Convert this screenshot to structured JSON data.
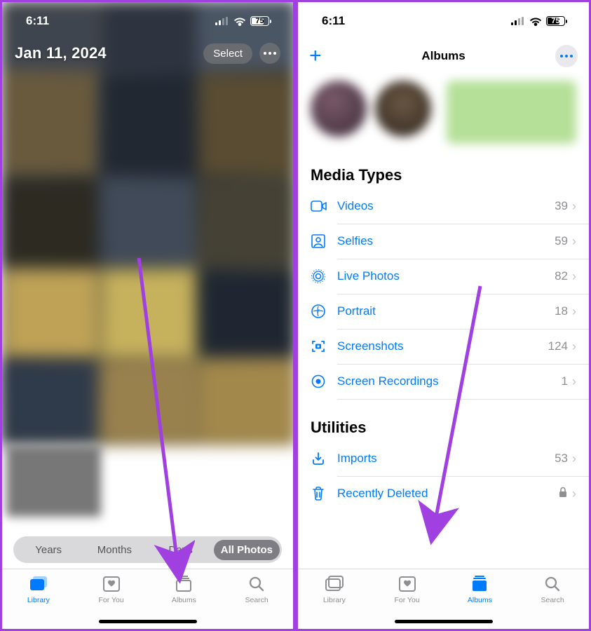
{
  "status": {
    "time": "6:11",
    "battery_pct": 75,
    "battery_label": "75"
  },
  "left": {
    "date_label": "Jan 11, 2024",
    "select_label": "Select",
    "segmented": [
      "Years",
      "Months",
      "Days",
      "All Photos"
    ],
    "active_segment_index": 3
  },
  "right": {
    "nav_title": "Albums",
    "sections": {
      "media_types": {
        "header": "Media Types",
        "items": [
          {
            "icon": "video",
            "label": "Videos",
            "count": 39
          },
          {
            "icon": "selfie",
            "label": "Selfies",
            "count": 59
          },
          {
            "icon": "live",
            "label": "Live Photos",
            "count": 82
          },
          {
            "icon": "portrait",
            "label": "Portrait",
            "count": 18
          },
          {
            "icon": "screenshot",
            "label": "Screenshots",
            "count": 124
          },
          {
            "icon": "record",
            "label": "Screen Recordings",
            "count": 1
          }
        ]
      },
      "utilities": {
        "header": "Utilities",
        "items": [
          {
            "icon": "import",
            "label": "Imports",
            "count": 53
          },
          {
            "icon": "trash",
            "label": "Recently Deleted",
            "locked": true
          }
        ]
      }
    }
  },
  "tabs": [
    {
      "key": "library",
      "label": "Library",
      "icon": "library"
    },
    {
      "key": "foryou",
      "label": "For You",
      "icon": "foryou"
    },
    {
      "key": "albums",
      "label": "Albums",
      "icon": "albums"
    },
    {
      "key": "search",
      "label": "Search",
      "icon": "search"
    }
  ],
  "left_active_tab": "library",
  "right_active_tab": "albums"
}
